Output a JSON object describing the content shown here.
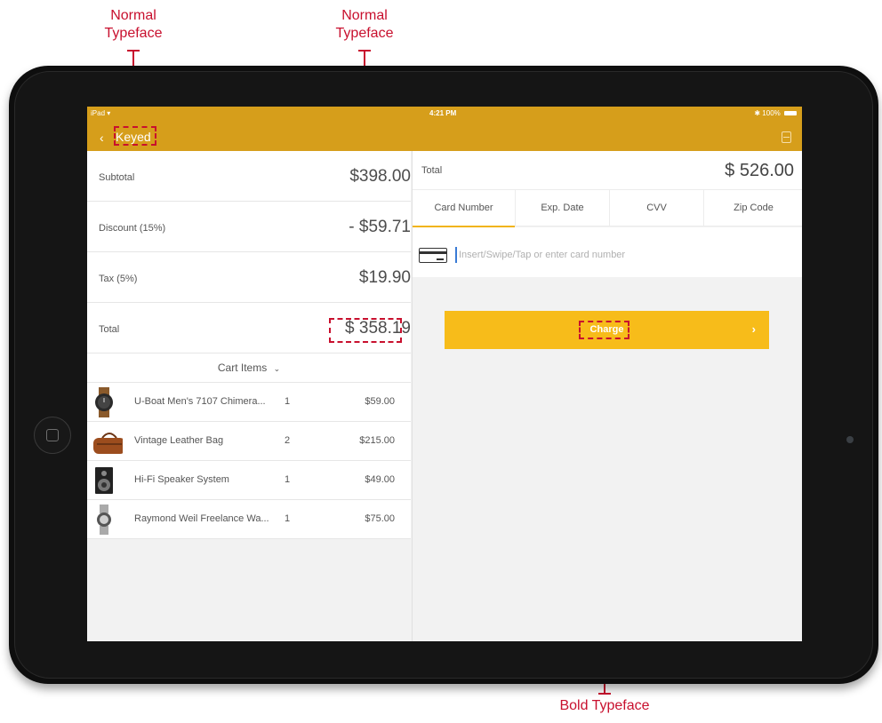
{
  "annotations": {
    "left_top": [
      "Normal",
      "Typeface"
    ],
    "mid_top": [
      "Normal",
      "Typeface"
    ],
    "bottom": "Bold Typeface"
  },
  "status_bar": {
    "carrier": "iPad",
    "wifi_icon": "wifi-icon",
    "time": "4:21 PM",
    "bluetooth_icon": "bluetooth-icon",
    "battery": "100%"
  },
  "nav": {
    "back_icon": "chevron-left-icon",
    "title": "Keyed",
    "receipt_icon": "receipt-icon"
  },
  "summary": {
    "subtotal_label": "Subtotal",
    "subtotal_value": "$398.00",
    "discount_label": "Discount (15%)",
    "discount_value": "- $59.71",
    "tax_label": "Tax (5%)",
    "tax_value": "$19.90",
    "total_label": "Total",
    "total_value": "$ 358.19"
  },
  "cart": {
    "header": "Cart Items",
    "toggle_icon": "chevron-down-icon",
    "items": [
      {
        "name": "U-Boat Men's 7107 Chimera...",
        "qty": "1",
        "price": "$59.00",
        "icon": "wristwatch-icon"
      },
      {
        "name": "Vintage Leather Bag",
        "qty": "2",
        "price": "$215.00",
        "icon": "leather-bag-icon"
      },
      {
        "name": "Hi-Fi Speaker System",
        "qty": "1",
        "price": "$49.00",
        "icon": "speaker-icon"
      },
      {
        "name": "Raymond Weil Freelance Wa...",
        "qty": "1",
        "price": "$75.00",
        "icon": "steel-watch-icon"
      }
    ]
  },
  "payment": {
    "total_label": "Total",
    "total_value": "$ 526.00",
    "tabs": [
      "Card Number",
      "Exp. Date",
      "CVV",
      "Zip Code"
    ],
    "active_tab": "Card Number",
    "card_placeholder": "Insert/Swipe/Tap or enter card number",
    "card_icon": "credit-card-icon",
    "charge_label": "Charge",
    "charge_icon": "chevron-right-icon"
  },
  "colors": {
    "nav_bar": "#d69e1b",
    "charge_button": "#f7bc1a",
    "annotation": "#c8102e",
    "active_tab_underline": "#f1b416"
  }
}
